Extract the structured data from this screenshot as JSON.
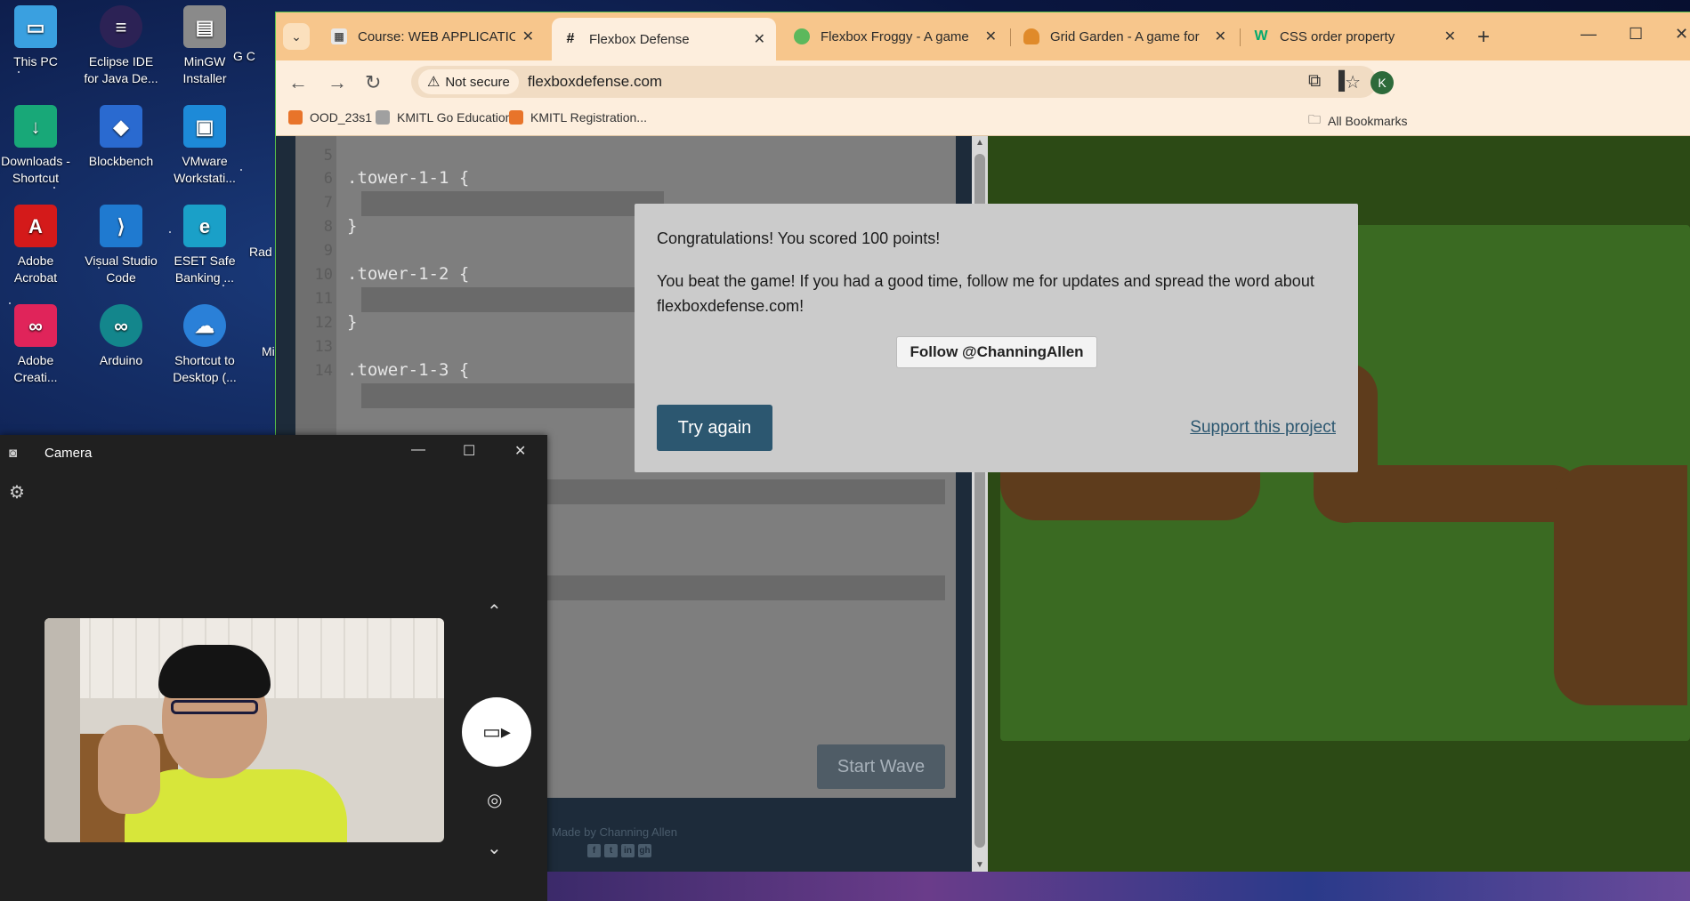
{
  "desktop": {
    "icons": [
      {
        "label": "This PC",
        "icon": "monitor-icon",
        "color": "#3aa0e0"
      },
      {
        "label": "Eclipse IDE for Java De...",
        "icon": "eclipse-icon",
        "color": "#2c2255"
      },
      {
        "label": "MinGW Installer",
        "icon": "installer-icon",
        "color": "#8a8a8a"
      },
      {
        "label": "Downloads - Shortcut",
        "icon": "download-folder-icon",
        "color": "#18a878"
      },
      {
        "label": "Blockbench",
        "icon": "blockbench-icon",
        "color": "#2a6ad0"
      },
      {
        "label": "VMware Workstati...",
        "icon": "vmware-icon",
        "color": "#1d8ad8"
      },
      {
        "label": "Adobe Acrobat",
        "icon": "acrobat-icon",
        "color": "#d41a1a"
      },
      {
        "label": "Visual Studio Code",
        "icon": "vscode-icon",
        "color": "#1f7ad0"
      },
      {
        "label": "ESET Safe Banking ...",
        "icon": "eset-icon",
        "color": "#1aa0c8"
      },
      {
        "label": "Adobe Creati...",
        "icon": "creative-cloud-icon",
        "color": "#e0245a"
      },
      {
        "label": "Arduino",
        "icon": "arduino-icon",
        "color": "#13868c"
      },
      {
        "label": "Shortcut to Desktop (...",
        "icon": "onedrive-icon",
        "color": "#2a80d8"
      }
    ],
    "partial_labels": [
      "G C",
      "Rad",
      "Mi"
    ]
  },
  "browser": {
    "tabs": [
      {
        "title": "Course: WEB APPLICATION",
        "icon": "moodle-icon",
        "active": false
      },
      {
        "title": "Flexbox Defense",
        "icon": "hash-icon",
        "active": true
      },
      {
        "title": "Flexbox Froggy - A game",
        "icon": "frog-icon",
        "active": false
      },
      {
        "title": "Grid Garden - A game for",
        "icon": "carrot-icon",
        "active": false
      },
      {
        "title": "CSS order property",
        "icon": "w3schools-icon",
        "active": false
      }
    ],
    "new_tab": "+",
    "address": {
      "security_label": "Not secure",
      "url": "flexboxdefense.com"
    },
    "profile_initial": "K",
    "bookmarks": [
      {
        "label": "OOD_23s1",
        "icon": "bookmark-favicon"
      },
      {
        "label": "KMITL Go Education",
        "icon": "bookmark-favicon"
      },
      {
        "label": "KMITL Registration...",
        "icon": "bookmark-favicon"
      }
    ],
    "all_bookmarks": "All Bookmarks"
  },
  "editor": {
    "lines": [
      {
        "n": "5",
        "code": ""
      },
      {
        "n": "6",
        "code": ".tower-1-1 {"
      },
      {
        "n": "7",
        "code": ""
      },
      {
        "n": "8",
        "code": "}"
      },
      {
        "n": "9",
        "code": ""
      },
      {
        "n": "10",
        "code": ".tower-1-2 {"
      },
      {
        "n": "11",
        "code": ""
      },
      {
        "n": "12",
        "code": "}"
      },
      {
        "n": "13",
        "code": ""
      },
      {
        "n": "14",
        "code": ".tower-1-3 {"
      }
    ],
    "start_wave": "Start Wave",
    "credit": "Made by Channing Allen",
    "social": [
      "f",
      "t",
      "in",
      "gh"
    ]
  },
  "modal": {
    "score_text": "Congratulations! You scored 100 points!",
    "beat_text": "You beat the game! If you had a good time, follow me for updates and spread the word about flexboxdefense.com!",
    "follow": "Follow @ChanningAllen",
    "try_again": "Try again",
    "support": "Support this project"
  },
  "camera": {
    "title": "Camera"
  },
  "colors": {
    "tabstrip": "#f7c68c",
    "toolbar": "#fdeedd",
    "modal_bg": "#cbcbcb",
    "try_again_bg": "#2c5770",
    "board_green": "#2c4a15",
    "path_brown": "#5e3c1c"
  }
}
